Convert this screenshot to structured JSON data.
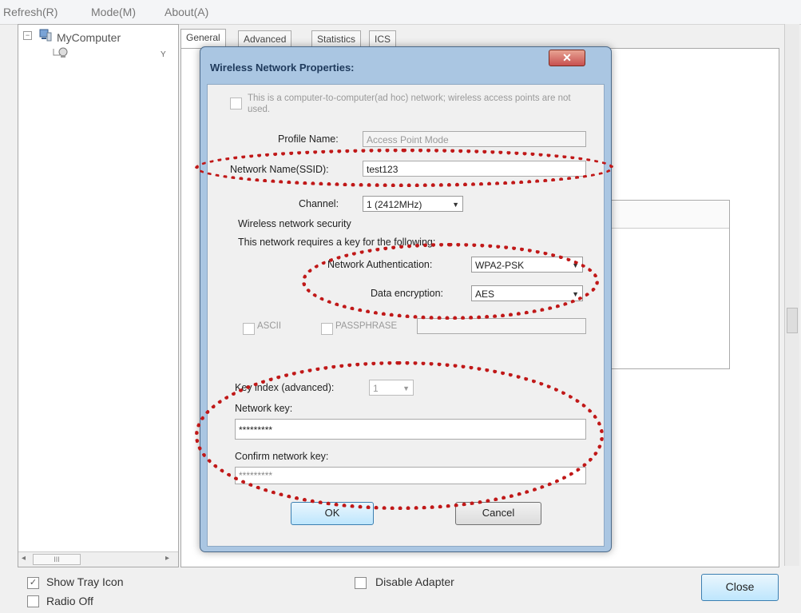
{
  "menubar": {
    "items": [
      "Refresh(R)",
      "Mode(M)",
      "About(A)"
    ]
  },
  "tree": {
    "root_label": "MyComputer",
    "expander": "−"
  },
  "tabs": [
    "General",
    "Advanced",
    "Statistics",
    "ICS"
  ],
  "dialog": {
    "title": "Wireless Network Properties:",
    "adhoc_text": "This is a computer-to-computer(ad hoc) network; wireless access points are not used.",
    "profile_name_label": "Profile Name:",
    "profile_name_value": "Access Point Mode",
    "ssid_label": "Network Name(SSID):",
    "ssid_value": "test123",
    "channel_label": "Channel:",
    "channel_value": "1 (2412MHz)",
    "security_heading": "Wireless network security",
    "security_text": "This network requires a key for the following:",
    "auth_label": "Network Authentication:",
    "auth_value": "WPA2-PSK",
    "encryption_label": "Data encryption:",
    "encryption_value": "AES",
    "ascii_label": "ASCII",
    "passphrase_label": "PASSPHRASE",
    "key_index_label": "Key index (advanced):",
    "key_index_value": "1",
    "network_key_label": "Network key:",
    "network_key_value": "*********",
    "confirm_key_label": "Confirm network key:",
    "confirm_key_value": "*********",
    "ok_label": "OK",
    "cancel_label": "Cancel"
  },
  "bottom": {
    "show_tray_icon": "Show Tray Icon",
    "radio_off": "Radio Off",
    "disable_adapter": "Disable Adapter",
    "close_label": "Close"
  },
  "scroll": {
    "tree_hscroll_label": "III"
  },
  "colors": {
    "highlight_dots": "#c01818",
    "dialog_frame": "#aac6e2"
  }
}
